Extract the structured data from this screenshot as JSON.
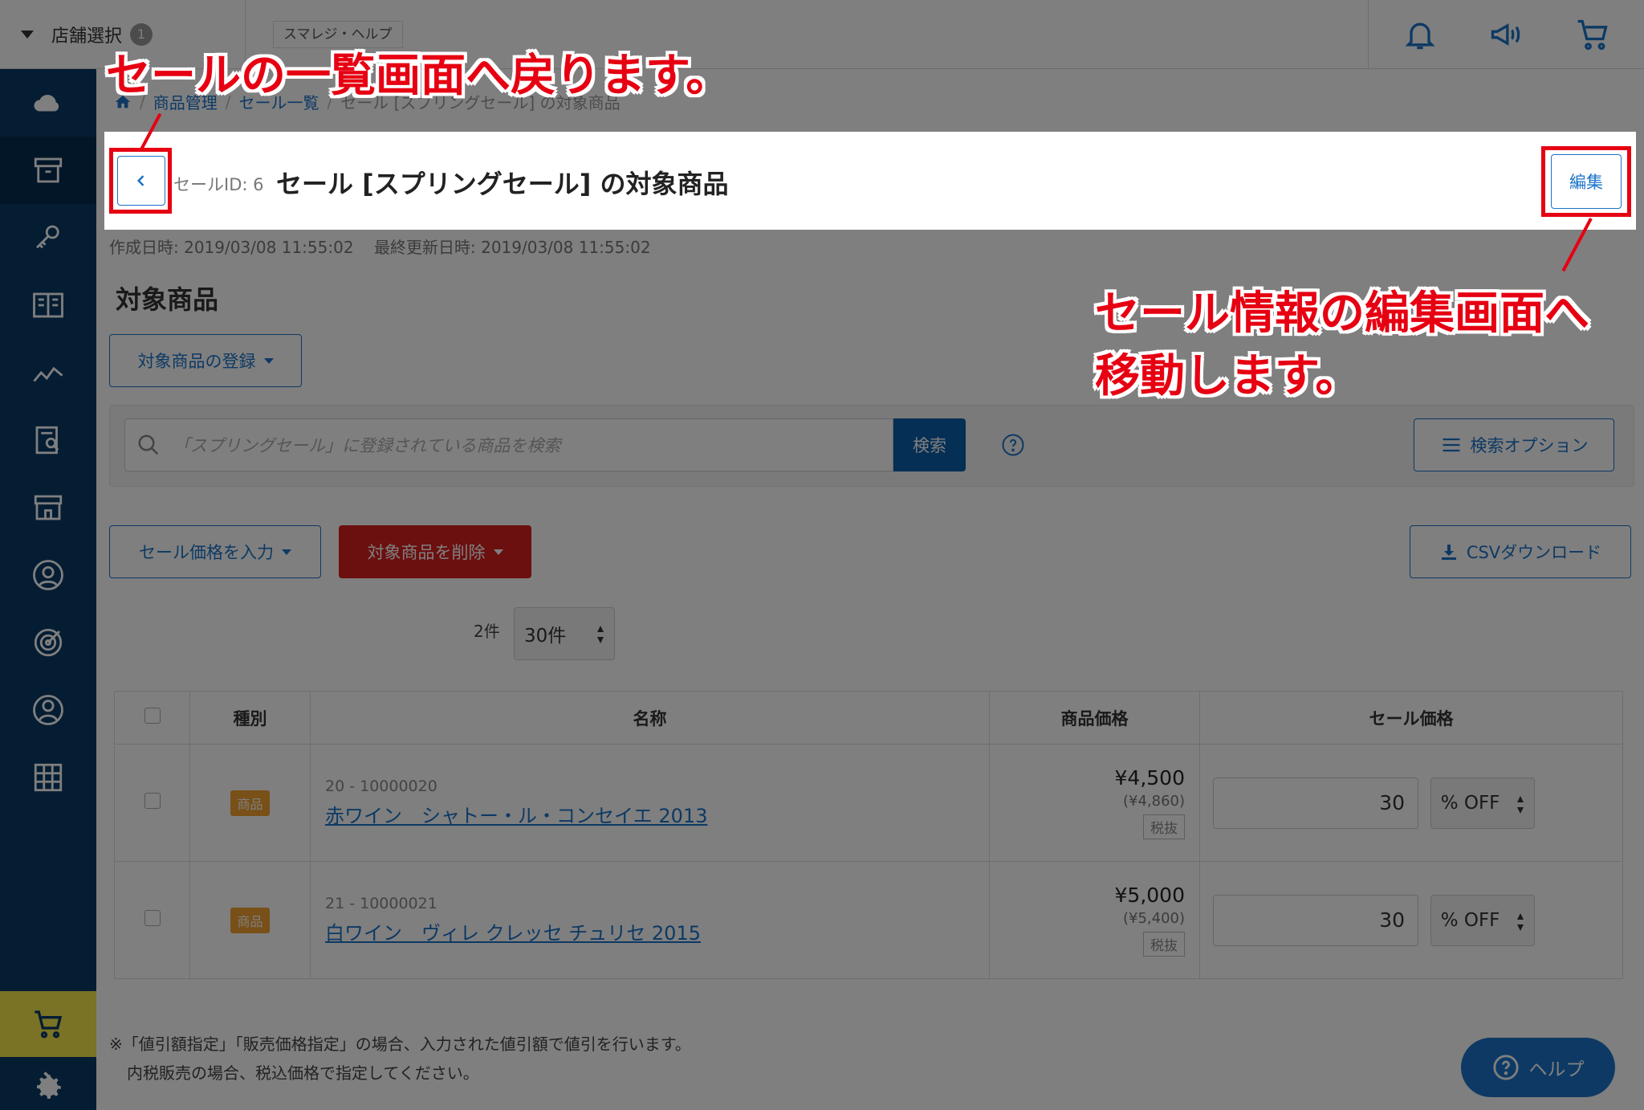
{
  "topbar": {
    "store_select_label": "店舗選択",
    "store_count": "1",
    "help_tab": "スマレジ・ヘルプ",
    "icons": [
      "bell-icon",
      "megaphone-icon",
      "cart-icon"
    ]
  },
  "sidebar": {
    "items": [
      "cloud-icon",
      "box-icon",
      "key-icon",
      "book-icon",
      "chart-icon",
      "report-icon",
      "store-icon",
      "user-circle-icon",
      "target-icon",
      "person-icon",
      "grid-icon"
    ],
    "bottom": [
      "cart-icon",
      "gear-icon",
      "chevron-right-icon"
    ]
  },
  "breadcrumb": {
    "items": [
      "商品管理",
      "セール一覧",
      "セール [スプリングセール] の対象商品"
    ]
  },
  "header": {
    "sale_id": "セールID: 6",
    "title": "セール [スプリングセール] の対象商品",
    "edit_label": "編集"
  },
  "timestamps": {
    "created": "作成日時: 2019/03/08 11:55:02",
    "updated": "最終更新日時: 2019/03/08 11:55:02"
  },
  "section": {
    "title": "対象商品",
    "register_label": "対象商品の登録"
  },
  "search": {
    "placeholder": "「スプリングセール」に登録されている商品を検索",
    "button": "検索",
    "options_label": "検索オプション"
  },
  "actions": {
    "price_label": "セール価格を入力",
    "delete_label": "対象商品を削除",
    "csv_label": "CSVダウンロード"
  },
  "pagination": {
    "count": "2件",
    "per_page": "30件"
  },
  "table": {
    "headers": [
      "種別",
      "名称",
      "商品価格",
      "セール価格"
    ],
    "rows": [
      {
        "type": "商品",
        "code": "20 - 10000020",
        "name": "赤ワイン　シャトー・ル・コンセイエ 2013",
        "price": "¥4,500",
        "price_tax": "(¥4,860)",
        "tax_label": "税抜",
        "sale_value": "30",
        "sale_unit": "% OFF"
      },
      {
        "type": "商品",
        "code": "21 - 10000021",
        "name": "白ワイン　ヴィレ クレッセ チュリセ 2015",
        "price": "¥5,000",
        "price_tax": "(¥5,400)",
        "tax_label": "税抜",
        "sale_value": "30",
        "sale_unit": "% OFF"
      }
    ]
  },
  "footnote": {
    "line1": "※「値引額指定」「販売価格指定」の場合、入力された値引額で値引を行います。",
    "line2": "内税販売の場合、税込価格で指定してください。"
  },
  "help_fab": "ヘルプ",
  "annotations": {
    "back": "セールの一覧画面へ戻ります。",
    "edit_line1": "セール情報の編集画面へ",
    "edit_line2": "移動します。"
  },
  "colors": {
    "sidebar": "#0b3a66",
    "accent": "#1a73c8",
    "danger": "#d81f1f",
    "annotation": "#e60012"
  }
}
